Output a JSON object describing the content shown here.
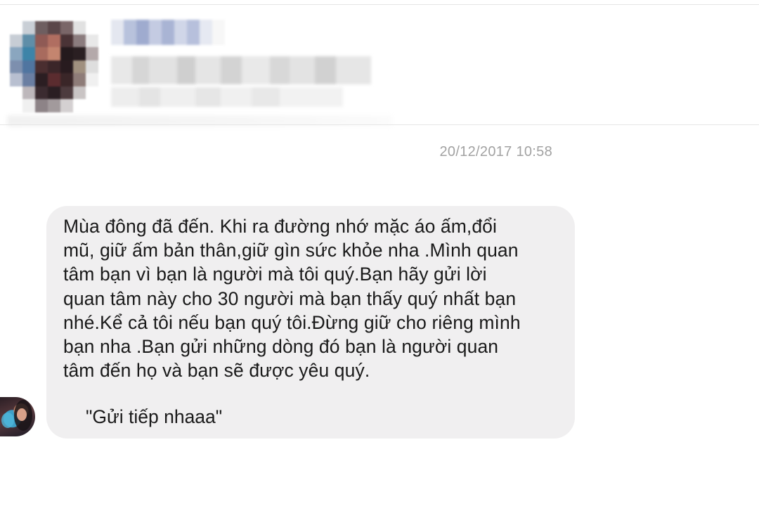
{
  "conversation": {
    "timestamp": "20/12/2017 10:58",
    "message": {
      "lines": [
        "Mùa đông đã đến. Khi ra đường nhớ mặc áo ấm,đổi",
        "mũ, giữ ấm bản thân,giữ gìn sức khỏe nha .Mình quan",
        "tâm bạn vì bạn là người mà tôi quý.Bạn hãy gửi lời",
        "quan tâm này cho 30 người mà bạn thấy quý nhất bạn",
        "nhé.Kể cả tôi nếu bạn quý tôi.Đừng giữ cho riêng mình",
        "bạn nha .Bạn gửi những dòng đó bạn là người quan",
        "tâm đến họ và bạn sẽ được yêu quý."
      ],
      "quote": "\"Gửi tiếp nhaaa\""
    }
  },
  "colors": {
    "bubble_background": "#f0eff0",
    "timestamp_text": "#a2a2a2",
    "message_text": "#1a1a1a"
  }
}
